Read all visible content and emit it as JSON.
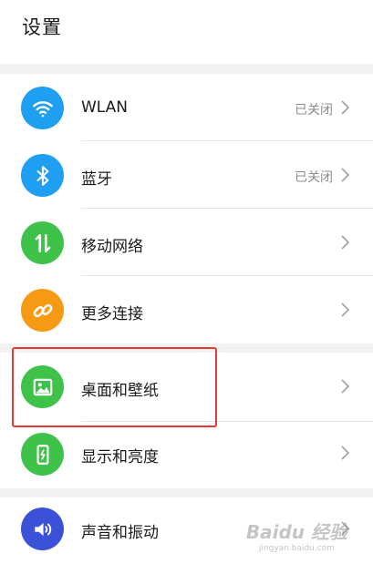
{
  "header": {
    "title": "设置"
  },
  "settings": [
    {
      "label": "WLAN",
      "status": "已关闭",
      "icon": "wifi-icon",
      "color": "#1e9ff2"
    },
    {
      "label": "蓝牙",
      "status": "已关闭",
      "icon": "bluetooth-icon",
      "color": "#1e9ff2"
    },
    {
      "label": "移动网络",
      "status": "",
      "icon": "mobile-data-icon",
      "color": "#3fc24a"
    },
    {
      "label": "更多连接",
      "status": "",
      "icon": "link-icon",
      "color": "#f59a12"
    },
    {
      "label": "桌面和壁纸",
      "status": "",
      "icon": "wallpaper-icon",
      "color": "#3fc24a"
    },
    {
      "label": "显示和亮度",
      "status": "",
      "icon": "display-brightness-icon",
      "color": "#3fc24a"
    },
    {
      "label": "声音和振动",
      "status": "",
      "icon": "sound-icon",
      "color": "#3b52d8"
    }
  ],
  "watermark": {
    "brand": "Baidu 经验",
    "url": "jingyan.baidu.com"
  },
  "colors": {
    "highlight": "#e53935",
    "background": "#f2f2f2"
  }
}
